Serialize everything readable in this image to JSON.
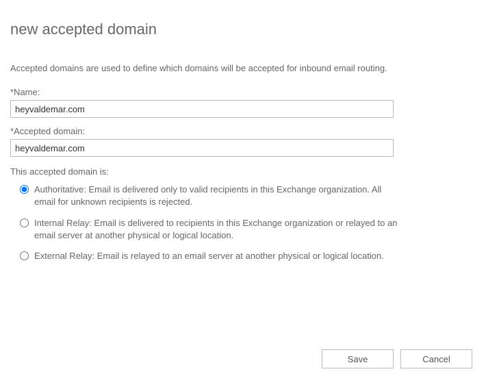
{
  "title": "new accepted domain",
  "description": "Accepted domains are used to define which domains will be accepted for inbound email routing.",
  "fields": {
    "name": {
      "label": "*Name:",
      "value": "heyvaldemar.com"
    },
    "accepted_domain": {
      "label": "*Accepted domain:",
      "value": "heyvaldemar.com"
    }
  },
  "domain_type": {
    "label": "This accepted domain is:",
    "selected": "authoritative",
    "options": {
      "authoritative": "Authoritative: Email is delivered only to valid recipients in this Exchange organization. All email for unknown recipients is rejected.",
      "internal_relay": "Internal Relay: Email is delivered to recipients in this Exchange organization or relayed to an email server at another physical or logical location.",
      "external_relay": "External Relay: Email is relayed to an email server at another physical or logical location."
    }
  },
  "buttons": {
    "save": "Save",
    "cancel": "Cancel"
  }
}
